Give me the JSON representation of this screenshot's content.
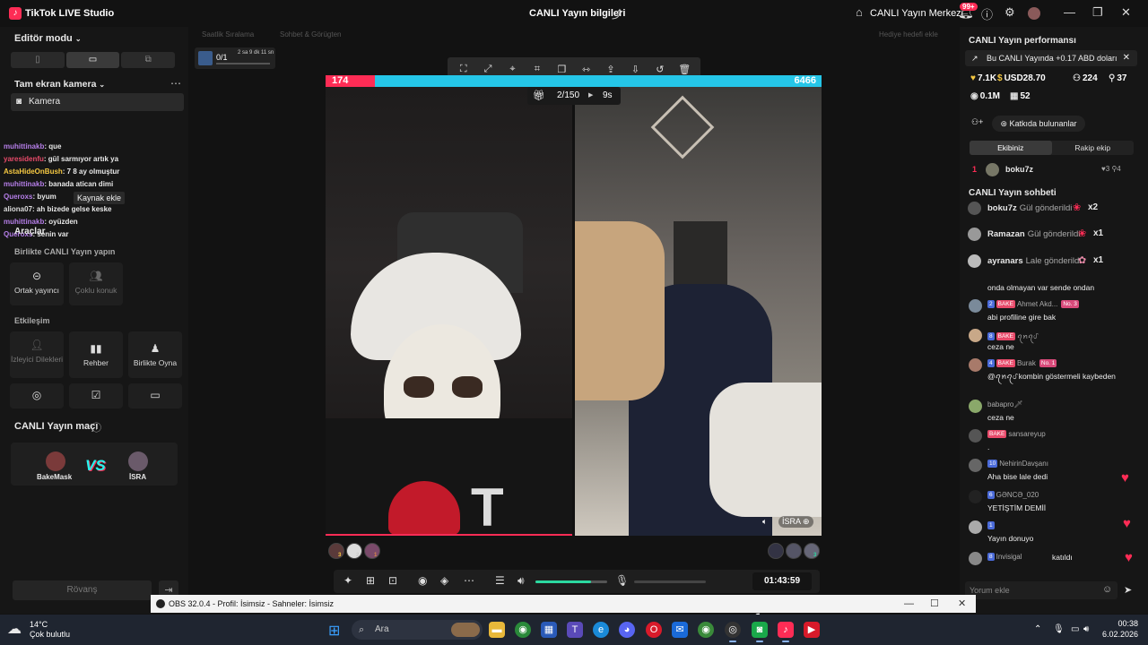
{
  "titlebar": {
    "app_name": "TikTok LIVE Studio",
    "center_title": "CANLI Yayın bilgileri",
    "live_center": "CANLI Yayın Merkezi",
    "notif_badge": "99+"
  },
  "left": {
    "editor_mode": "Editör modu",
    "fullscreen_camera": "Tam ekran kamera",
    "camera_label": "Kamera",
    "add_source": "Kaynak ekle",
    "tools_title": "Araçlar",
    "together_title": "Birlikte CANLI Yayın yapın",
    "co_host": "Ortak yayıncı",
    "multi_guest": "Çoklu konuk",
    "interaction_title": "Etkileşim",
    "viewer_wishes": "İzleyici Dilekleri",
    "guide": "Rehber",
    "play_together": "Birlikte Oyna",
    "match_title": "CANLI Yayın maçı",
    "player1": "BakeMask",
    "vs": "VS",
    "player2": "İSRA",
    "revenge": "Rövanş"
  },
  "overlay_chat": [
    {
      "name": "muhittinakb",
      "text": ": que",
      "color": "#b57ee8"
    },
    {
      "name": "yaresidenfu",
      "text": ": gül sarmıyor artık ya",
      "color": "#e84a6a"
    },
    {
      "name": "AstaHideOnBush",
      "text": ": 7 8 ay olmuştur",
      "color": "#f5c842"
    },
    {
      "name": "muhittinakb",
      "text": ": banada atican dimi",
      "color": "#b57ee8"
    },
    {
      "name": "Queroxs",
      "text": ": byum",
      "color": "#b57ee8"
    },
    {
      "name": "aliona07",
      "text": ": ah bizede gelse keske",
      "color": "#dddddd"
    },
    {
      "name": "muhittinakb",
      "text": ": oyüzden",
      "color": "#b57ee8"
    },
    {
      "name": "Queroxs",
      "text": ": senin var",
      "color": "#b57ee8"
    }
  ],
  "widgets": {
    "scene1": "Saatlik Sıralama",
    "scene2": "Sohbet & Görügten",
    "scene3": "Hediye hedefi ekle",
    "goal_count": "0/1",
    "goal_time": "2 sa 9 dk 11 sn"
  },
  "video": {
    "score_left": "174",
    "score_right": "6466",
    "gift_counter": "2/150",
    "seconds": "9s",
    "right_name": "İSRA",
    "left_viewer_counts": [
      "3",
      "2",
      "1"
    ],
    "right_viewer_counts": [
      "3"
    ]
  },
  "controls": {
    "timer": "01:43:59",
    "volume_level": 0.78
  },
  "right": {
    "perf_title": "CANLI Yayın performansı",
    "perf_banner": "Bu CANLI Yayında +0.17 ABD doları",
    "stats": [
      {
        "icon": "diamond-icon",
        "value": "7.1K"
      },
      {
        "icon": "dollar-icon",
        "value": "USD28.70"
      },
      {
        "icon": "users-icon",
        "value": "224"
      },
      {
        "icon": "person-icon",
        "value": "37"
      },
      {
        "icon": "eye-icon",
        "value": "0.1M"
      },
      {
        "icon": "gift-icon",
        "value": "52"
      }
    ],
    "contributors_btn": "Katkıda bulunanlar",
    "tab_our_team": "Ekibiniz",
    "tab_rival": "Rakip ekip",
    "rank": {
      "num": "1",
      "name": "boku7z",
      "hearts": "3",
      "people": "4"
    },
    "chat_title": "CANLI Yayın sohbeti",
    "gifts": [
      {
        "name": "boku7z",
        "text": "Gül gönderildi",
        "mult": "x2"
      },
      {
        "name": "Ramazan",
        "text": "Gül gönderildi",
        "mult": "x1"
      },
      {
        "name": "ayranars",
        "text": "Lale gönderildi",
        "mult": "x1"
      }
    ],
    "partial_msg": "onda olmayan var sende ondan",
    "messages": [
      {
        "lvl": "2",
        "fan": "BAKE",
        "name": "Ahmet Akd...",
        "no": "No. 3",
        "text": "abi profiline gire bak"
      },
      {
        "lvl": "8",
        "fan": "BAKE",
        "name": "ꪖꪀꪖᦔ",
        "no": "",
        "text": "ceza ne"
      },
      {
        "lvl": "4",
        "fan": "BAKE",
        "name": "Burak",
        "no": "No. 1",
        "text": "@ꪖꪀꪖᦔ kombin göstermeli kaybeden"
      },
      {
        "lvl": "",
        "fan": "",
        "name": "babapro🗡",
        "no": "",
        "text": "ceza ne"
      },
      {
        "lvl": "",
        "fan": "BAKE",
        "name": "sansareyup",
        "no": "",
        "text": "."
      },
      {
        "lvl": "10",
        "fan": "",
        "name": "NehirinDavşanı",
        "no": "",
        "text": "Aha bise lale dedi"
      },
      {
        "lvl": "6",
        "fan": "",
        "name": "GƏNCƏ_020",
        "no": "",
        "text": "YETİŞTİM DEMİİ"
      },
      {
        "lvl": "1",
        "fan": "",
        "name": "",
        "no": "",
        "text": "Yayın donuyo"
      },
      {
        "lvl": "8",
        "fan": "",
        "name": "Invisigal",
        "no": "",
        "text": "katıldı"
      }
    ],
    "comment_placeholder": "Yorum ekle"
  },
  "obs": {
    "title": "OBS 32.0.4 - Profil: İsimsiz - Sahneler: İsimsiz"
  },
  "taskbar": {
    "temp": "14°C",
    "condition": "Çok bulutlu",
    "search_placeholder": "Ara",
    "time": "00:38",
    "date": "6.02.2026"
  },
  "colors": {
    "accent_pink": "#fe2c55",
    "accent_cyan": "#25c6e8",
    "volume_green": "#2bd9a0"
  }
}
